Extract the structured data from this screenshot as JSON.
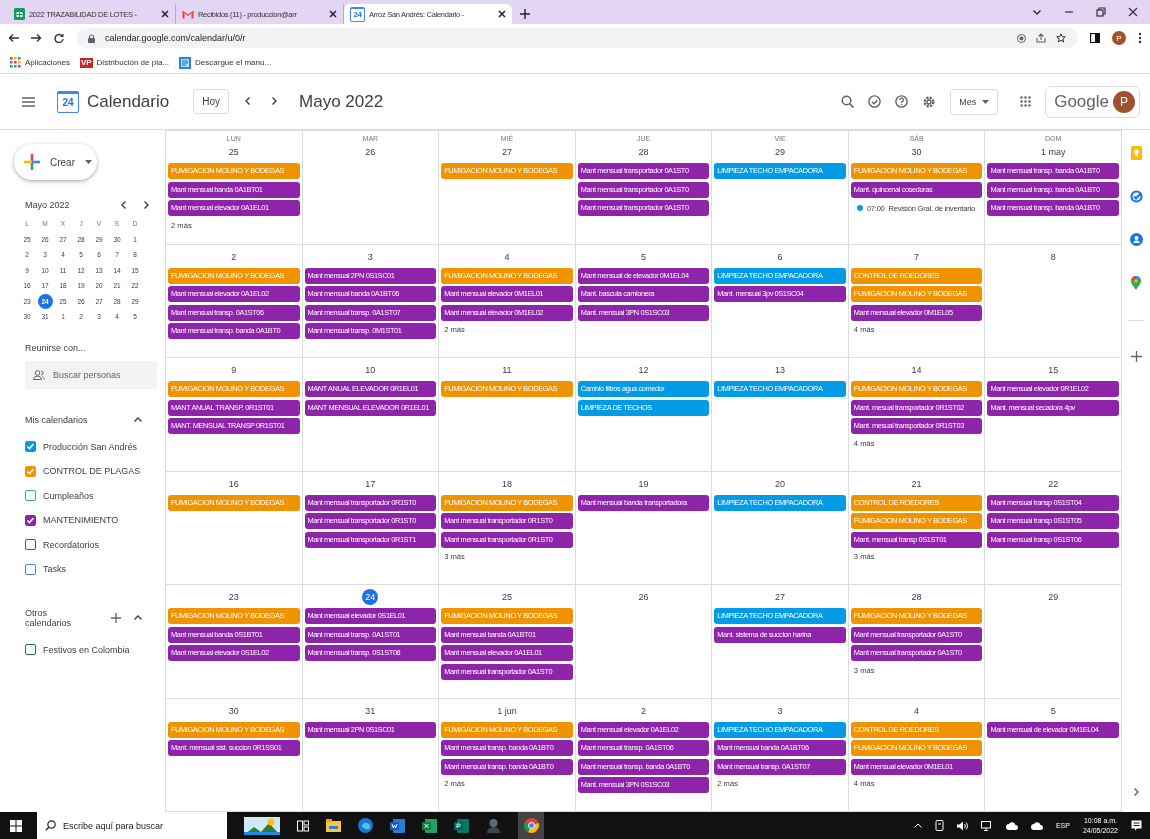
{
  "browser": {
    "tabs": [
      {
        "title": "2022 TRAZABILIDAD DE LOTES -",
        "selected": false
      },
      {
        "title": "Recibidos (11) - produccion@arr",
        "selected": false
      },
      {
        "title": "Arroz San Andrés: Calendario -",
        "badge": "24",
        "selected": true
      }
    ],
    "address": "calendar.google.com/calendar/u/0/r",
    "profile": "P",
    "bookmarks": [
      {
        "label": "Aplicaciones"
      },
      {
        "label": "Distribución de pla...",
        "badge": "VP"
      },
      {
        "label": "Descargue el manu..."
      }
    ]
  },
  "header": {
    "logo_text": "24",
    "app_name": "Calendario",
    "today_button": "Hoy",
    "period": "Mayo 2022",
    "view": "Mes",
    "brand": "Google",
    "avatar": "P"
  },
  "sidebar": {
    "create": "Crear",
    "mini_calendar": {
      "title": "Mayo 2022",
      "weekdays": [
        "L",
        "M",
        "X",
        "J",
        "V",
        "S",
        "D"
      ],
      "weeks": [
        [
          {
            "day": "25",
            "today": false
          },
          {
            "day": "26",
            "today": false
          },
          {
            "day": "27",
            "today": false
          },
          {
            "day": "28",
            "today": false
          },
          {
            "day": "29",
            "today": false
          },
          {
            "day": "30",
            "today": false
          },
          {
            "day": "1",
            "today": false
          }
        ],
        [
          {
            "day": "2",
            "today": false
          },
          {
            "day": "3",
            "today": false
          },
          {
            "day": "4",
            "today": false
          },
          {
            "day": "5",
            "today": false
          },
          {
            "day": "6",
            "today": false
          },
          {
            "day": "7",
            "today": false
          },
          {
            "day": "8",
            "today": false
          }
        ],
        [
          {
            "day": "9",
            "today": false
          },
          {
            "day": "10",
            "today": false
          },
          {
            "day": "11",
            "today": false
          },
          {
            "day": "12",
            "today": false
          },
          {
            "day": "13",
            "today": false
          },
          {
            "day": "14",
            "today": false
          },
          {
            "day": "15",
            "today": false
          }
        ],
        [
          {
            "day": "16",
            "today": false
          },
          {
            "day": "17",
            "today": false
          },
          {
            "day": "18",
            "today": false
          },
          {
            "day": "19",
            "today": false
          },
          {
            "day": "20",
            "today": false
          },
          {
            "day": "21",
            "today": false
          },
          {
            "day": "22",
            "today": false
          }
        ],
        [
          {
            "day": "23",
            "today": false
          },
          {
            "day": "24",
            "today": true
          },
          {
            "day": "25",
            "today": false
          },
          {
            "day": "26",
            "today": false
          },
          {
            "day": "27",
            "today": false
          },
          {
            "day": "28",
            "today": false
          },
          {
            "day": "29",
            "today": false
          }
        ],
        [
          {
            "day": "30",
            "today": false
          },
          {
            "day": "31",
            "today": false
          },
          {
            "day": "1",
            "today": false
          },
          {
            "day": "2",
            "today": false
          },
          {
            "day": "3",
            "today": false
          },
          {
            "day": "4",
            "today": false
          },
          {
            "day": "5",
            "today": false
          }
        ]
      ]
    },
    "meet": {
      "title": "Reunirse con...",
      "placeholder": "Buscar personas"
    },
    "my_calendars": {
      "title": "Mis calendarios",
      "expanded": true,
      "items": [
        {
          "label": "Producción San Andrés",
          "checked": true,
          "color": "#039be5"
        },
        {
          "label": "CONTROL DE PLAGAS",
          "checked": true,
          "color": "#f09300"
        },
        {
          "label": "Cumpleaños",
          "checked": false,
          "color": "#33b679"
        },
        {
          "label": "MANTENIMIENTO",
          "checked": true,
          "color": "#8e24aa"
        },
        {
          "label": "Recordatorios",
          "checked": false,
          "color": "#3f51b5"
        },
        {
          "label": "Tasks",
          "checked": false,
          "color": "#4285f4"
        }
      ]
    },
    "other_calendars": {
      "title": "Otros calendarios",
      "expanded": true,
      "items": [
        {
          "label": "Festivos en Colombia",
          "checked": false,
          "color": "#0b8043"
        }
      ]
    }
  },
  "calendar": {
    "weekdays": [
      "LUN",
      "MAR",
      "MIÉ",
      "JUE",
      "VIE",
      "SÁB",
      "DOM"
    ],
    "weeks": [
      {
        "days": [
          {
            "date": "25",
            "today": false,
            "events": [
              {
                "kind": "block",
                "title": "FUMIGACION MOLINO Y BODEGAS",
                "color": "#f09300"
              },
              {
                "kind": "block",
                "title": "Mant mensual banda 0A1BT01",
                "color": "#8e24aa"
              },
              {
                "kind": "block",
                "title": "Mant mensual elevador 0A1EL01",
                "color": "#8e24aa"
              }
            ],
            "more": "2 más"
          },
          {
            "date": "26",
            "today": false
          },
          {
            "date": "27",
            "today": false,
            "events": [
              {
                "kind": "block",
                "title": "FUMIGACION MOLINO Y BODEGAS",
                "color": "#f09300"
              }
            ]
          },
          {
            "date": "28",
            "today": false,
            "events": [
              {
                "kind": "block",
                "title": "Mant mensual transportador 0A1ST0",
                "color": "#8e24aa"
              },
              {
                "kind": "block",
                "title": "Mant mensual transportador 0A1ST0",
                "color": "#8e24aa"
              },
              {
                "kind": "block",
                "title": "Mant mensual transportador 0A1ST0",
                "color": "#8e24aa"
              }
            ]
          },
          {
            "date": "29",
            "today": false,
            "events": [
              {
                "kind": "block",
                "title": "LIMPIEZA TECHO EMPACADORA",
                "color": "#039be5"
              }
            ]
          },
          {
            "date": "30",
            "today": false,
            "events": [
              {
                "kind": "block",
                "title": "FUMIGACION MOLINO Y BODEGAS",
                "color": "#f09300"
              },
              {
                "kind": "block",
                "title": "Mant. quincenal cosedoras",
                "color": "#8e24aa"
              },
              {
                "kind": "timed",
                "time": "07:00",
                "title": "Revisión Gral. de inventario",
                "color": "#039be5"
              }
            ]
          },
          {
            "date": "1 may",
            "today": false,
            "events": [
              {
                "kind": "block",
                "title": "Mant mensual transp. banda 0A1BT0",
                "color": "#8e24aa"
              },
              {
                "kind": "block",
                "title": "Mant mensual transp. banda 0A1BT0",
                "color": "#8e24aa"
              },
              {
                "kind": "block",
                "title": "Mant mensual transp. banda 0A1BT0",
                "color": "#8e24aa"
              }
            ]
          }
        ]
      },
      {
        "days": [
          {
            "date": "2",
            "today": false,
            "events": [
              {
                "kind": "block",
                "title": "FUMIGACION MOLINO Y BODEGAS",
                "color": "#f09300"
              },
              {
                "kind": "block",
                "title": "Mant mensual elevador 0A1EL02",
                "color": "#8e24aa"
              },
              {
                "kind": "block",
                "title": "Mant mensual transp. 0A1ST06",
                "color": "#8e24aa"
              },
              {
                "kind": "block",
                "title": "Mant mensual transp. banda 0A1BT0",
                "color": "#8e24aa"
              }
            ]
          },
          {
            "date": "3",
            "today": false,
            "events": [
              {
                "kind": "block",
                "title": "Mant mensual 2PN 0S1SC01",
                "color": "#8e24aa"
              },
              {
                "kind": "block",
                "title": "Mant mensual banda 0A1BT06",
                "color": "#8e24aa"
              },
              {
                "kind": "block",
                "title": "Mant mensual transp. 0A1ST07",
                "color": "#8e24aa"
              },
              {
                "kind": "block",
                "title": "Mant mensual transp. 0M1ST01",
                "color": "#8e24aa"
              }
            ]
          },
          {
            "date": "4",
            "today": false,
            "events": [
              {
                "kind": "block",
                "title": "FUMIGACION MOLINO Y BODEGAS",
                "color": "#f09300"
              },
              {
                "kind": "block",
                "title": "Mant mensual elevador 0M1EL01",
                "color": "#8e24aa"
              },
              {
                "kind": "block",
                "title": "Mant mensual elevador 0M1EL02",
                "color": "#8e24aa"
              }
            ],
            "more": "2 más"
          },
          {
            "date": "5",
            "today": false,
            "events": [
              {
                "kind": "block",
                "title": "Mant mensual de elevador 0M1EL04",
                "color": "#8e24aa"
              },
              {
                "kind": "block",
                "title": "Mant. bascula camionera",
                "color": "#8e24aa"
              },
              {
                "kind": "block",
                "title": "Mant. mensual 3PN 0S1SC03",
                "color": "#8e24aa"
              }
            ]
          },
          {
            "date": "6",
            "today": false,
            "events": [
              {
                "kind": "block",
                "title": "LIMPIEZA TECHO EMPACADORA",
                "color": "#039be5"
              },
              {
                "kind": "block",
                "title": "Mant. mensual 3pv 0S1SC04",
                "color": "#8e24aa"
              }
            ]
          },
          {
            "date": "7",
            "today": false,
            "events": [
              {
                "kind": "block",
                "title": "CONTROL DE ROEDORES",
                "color": "#f09300"
              },
              {
                "kind": "block",
                "title": "FUMIGACION MOLINO Y BODEGAS",
                "color": "#f09300"
              },
              {
                "kind": "block",
                "title": "Mant mensual elevador 0M1EL05",
                "color": "#8e24aa"
              }
            ],
            "more": "4 más"
          },
          {
            "date": "8",
            "today": false
          }
        ]
      },
      {
        "days": [
          {
            "date": "9",
            "today": false,
            "events": [
              {
                "kind": "block",
                "title": "FUMIGACION MOLINO Y BODEGAS",
                "color": "#f09300"
              },
              {
                "kind": "block",
                "title": "MANT ANUAL TRANSP. 0R1ST01",
                "color": "#8e24aa"
              },
              {
                "kind": "block",
                "title": "MANT. MENSUAL TRANSP 0R1ST01",
                "color": "#8e24aa"
              }
            ]
          },
          {
            "date": "10",
            "today": false,
            "events": [
              {
                "kind": "block",
                "title": "MANT ANUAL ELEVADOR 0R1EL01",
                "color": "#8e24aa"
              },
              {
                "kind": "block",
                "title": "MANT MENSUAL ELEVADOR 0R1EL01",
                "color": "#8e24aa"
              }
            ]
          },
          {
            "date": "11",
            "today": false,
            "events": [
              {
                "kind": "block",
                "title": "FUMIGACION MOLINO Y BODEGAS",
                "color": "#f09300"
              }
            ]
          },
          {
            "date": "12",
            "today": false,
            "events": [
              {
                "kind": "block",
                "title": "Cambio filtros agua comedor",
                "color": "#039be5"
              },
              {
                "kind": "block",
                "title": "LIMPIEZA DE TECHOS",
                "color": "#039be5"
              }
            ]
          },
          {
            "date": "13",
            "today": false,
            "events": [
              {
                "kind": "block",
                "title": "LIMPIEZA TECHO EMPACADORA",
                "color": "#039be5"
              }
            ]
          },
          {
            "date": "14",
            "today": false,
            "events": [
              {
                "kind": "block",
                "title": "FUMIGACION MOLINO Y BODEGAS",
                "color": "#f09300"
              },
              {
                "kind": "block",
                "title": "Mant. mesual transportador 0R1ST02",
                "color": "#8e24aa"
              },
              {
                "kind": "block",
                "title": "Mant. mesual transportador 0R1ST03",
                "color": "#8e24aa"
              }
            ],
            "more": "4 más"
          },
          {
            "date": "15",
            "today": false,
            "events": [
              {
                "kind": "block",
                "title": "Mant mensual elevador 0R1EL02",
                "color": "#8e24aa"
              },
              {
                "kind": "block",
                "title": "Mant. mensual secadora 4pv",
                "color": "#8e24aa"
              }
            ]
          }
        ]
      },
      {
        "days": [
          {
            "date": "16",
            "today": false,
            "events": [
              {
                "kind": "block",
                "title": "FUMIGACION MOLINO Y BODEGAS",
                "color": "#f09300"
              }
            ]
          },
          {
            "date": "17",
            "today": false,
            "events": [
              {
                "kind": "block",
                "title": "Mant mensual transportador 0R1ST0",
                "color": "#8e24aa"
              },
              {
                "kind": "block",
                "title": "Mant mensual transportador 0R1ST0",
                "color": "#8e24aa"
              },
              {
                "kind": "block",
                "title": "Mant mensual transportador 0R1ST1",
                "color": "#8e24aa"
              }
            ]
          },
          {
            "date": "18",
            "today": false,
            "events": [
              {
                "kind": "block",
                "title": "FUMIGACION MOLINO Y BODEGAS",
                "color": "#f09300"
              },
              {
                "kind": "block",
                "title": "Mant mensual transportador 0R1ST0",
                "color": "#8e24aa"
              },
              {
                "kind": "block",
                "title": "Mant mensual transportador 0R1ST0",
                "color": "#8e24aa"
              }
            ],
            "more": "3 más"
          },
          {
            "date": "19",
            "today": false,
            "events": [
              {
                "kind": "block",
                "title": "Mant mensual banda transportadora",
                "color": "#8e24aa"
              }
            ]
          },
          {
            "date": "20",
            "today": false,
            "events": [
              {
                "kind": "block",
                "title": "LIMPIEZA TECHO EMPACADORA",
                "color": "#039be5"
              }
            ]
          },
          {
            "date": "21",
            "today": false,
            "events": [
              {
                "kind": "block",
                "title": "CONTROL DE ROEDORES",
                "color": "#f09300"
              },
              {
                "kind": "block",
                "title": "FUMIGACION MOLINO Y BODEGAS",
                "color": "#f09300"
              },
              {
                "kind": "block",
                "title": "Mant. mensual transp 0S1ST01",
                "color": "#8e24aa"
              }
            ],
            "more": "3 más"
          },
          {
            "date": "22",
            "today": false,
            "events": [
              {
                "kind": "block",
                "title": "Mant mensual transp 0S1ST04",
                "color": "#8e24aa"
              },
              {
                "kind": "block",
                "title": "Mant mensual transp 0S1ST05",
                "color": "#8e24aa"
              },
              {
                "kind": "block",
                "title": "Mant mensual transp 0S1ST06",
                "color": "#8e24aa"
              }
            ]
          }
        ]
      },
      {
        "days": [
          {
            "date": "23",
            "today": false,
            "events": [
              {
                "kind": "block",
                "title": "FUMIGACION MOLINO Y BODEGAS",
                "color": "#f09300"
              },
              {
                "kind": "block",
                "title": "Mant mensual banda 0S1BT01",
                "color": "#8e24aa"
              },
              {
                "kind": "block",
                "title": "Mant mensual elevador 0S1EL02",
                "color": "#8e24aa"
              }
            ]
          },
          {
            "date": "24",
            "today": true,
            "events": [
              {
                "kind": "block",
                "title": "Mant mensual elevador 0S1EL01",
                "color": "#8e24aa"
              },
              {
                "kind": "block",
                "title": "Mant mensual transp. 0A1ST01",
                "color": "#8e24aa"
              },
              {
                "kind": "block",
                "title": "Mant mensual transp. 0S1ST08",
                "color": "#8e24aa"
              }
            ]
          },
          {
            "date": "25",
            "today": false,
            "events": [
              {
                "kind": "block",
                "title": "FUMIGACION MOLINO Y BODEGAS",
                "color": "#f09300"
              },
              {
                "kind": "block",
                "title": "Mant mensual banda 0A1BT01",
                "color": "#8e24aa"
              },
              {
                "kind": "block",
                "title": "Mant mensual elevador 0A1EL01",
                "color": "#8e24aa"
              },
              {
                "kind": "block",
                "title": "Mant mensual transportador 0A1ST0",
                "color": "#8e24aa"
              }
            ]
          },
          {
            "date": "26",
            "today": false
          },
          {
            "date": "27",
            "today": false,
            "events": [
              {
                "kind": "block",
                "title": "LIMPIEZA TECHO EMPACADORA",
                "color": "#039be5"
              },
              {
                "kind": "block",
                "title": "Mant. sistema de succion harina",
                "color": "#8e24aa"
              }
            ]
          },
          {
            "date": "28",
            "today": false,
            "events": [
              {
                "kind": "block",
                "title": "FUMIGACION MOLINO Y BODEGAS",
                "color": "#f09300"
              },
              {
                "kind": "block",
                "title": "Mant mensual transportador 0A1ST0",
                "color": "#8e24aa"
              },
              {
                "kind": "block",
                "title": "Mant mensual transportador 0A1ST0",
                "color": "#8e24aa"
              }
            ],
            "more": "3 más"
          },
          {
            "date": "29",
            "today": false
          }
        ]
      },
      {
        "days": [
          {
            "date": "30",
            "today": false,
            "events": [
              {
                "kind": "block",
                "title": "FUMIGACION MOLINO Y BODEGAS",
                "color": "#f09300"
              },
              {
                "kind": "block",
                "title": "Mant. mensual sist. succion 0R1SS01",
                "color": "#8e24aa"
              }
            ]
          },
          {
            "date": "31",
            "today": false,
            "events": [
              {
                "kind": "block",
                "title": "Mant mensual 2PN 0S1SC01",
                "color": "#8e24aa"
              }
            ]
          },
          {
            "date": "1 jun",
            "today": false,
            "events": [
              {
                "kind": "block",
                "title": "FUMIGACION MOLINO Y BODEGAS",
                "color": "#f09300"
              },
              {
                "kind": "block",
                "title": "Mant mensual transp. banda 0A1BT0",
                "color": "#8e24aa"
              },
              {
                "kind": "block",
                "title": "Mant mensual transp. banda 0A1BT0",
                "color": "#8e24aa"
              }
            ],
            "more": "2 más"
          },
          {
            "date": "2",
            "today": false,
            "events": [
              {
                "kind": "block",
                "title": "Mant mensual elevador 0A1EL02",
                "color": "#8e24aa"
              },
              {
                "kind": "block",
                "title": "Mant mensual transp. 0A1ST06",
                "color": "#8e24aa"
              },
              {
                "kind": "block",
                "title": "Mant mensual transp. banda 0A1BT0",
                "color": "#8e24aa"
              },
              {
                "kind": "block",
                "title": "Mant. mensual 3PN 0S1SC03",
                "color": "#8e24aa"
              }
            ]
          },
          {
            "date": "3",
            "today": false,
            "events": [
              {
                "kind": "block",
                "title": "LIMPIEZA TECHO EMPACADORA",
                "color": "#039be5"
              },
              {
                "kind": "block",
                "title": "Mant mensual banda 0A1BT06",
                "color": "#8e24aa"
              },
              {
                "kind": "block",
                "title": "Mant mensual transp. 0A1ST07",
                "color": "#8e24aa"
              }
            ],
            "more": "2 más"
          },
          {
            "date": "4",
            "today": false,
            "events": [
              {
                "kind": "block",
                "title": "CONTROL DE ROEDORES",
                "color": "#f09300"
              },
              {
                "kind": "block",
                "title": "FUMIGACION MOLINO Y BODEGAS",
                "color": "#f09300"
              },
              {
                "kind": "block",
                "title": "Mant mensual elevador 0M1EL01",
                "color": "#8e24aa"
              }
            ],
            "more": "4 más"
          },
          {
            "date": "5",
            "today": false,
            "events": [
              {
                "kind": "block",
                "title": "Mant mensual de elevador 0M1EL04",
                "color": "#8e24aa"
              }
            ]
          }
        ]
      }
    ]
  },
  "taskbar": {
    "search_placeholder": "Escribe aquí para buscar",
    "language": "ESP",
    "time": "10:08 a.m.",
    "date": "24/05/2022"
  }
}
